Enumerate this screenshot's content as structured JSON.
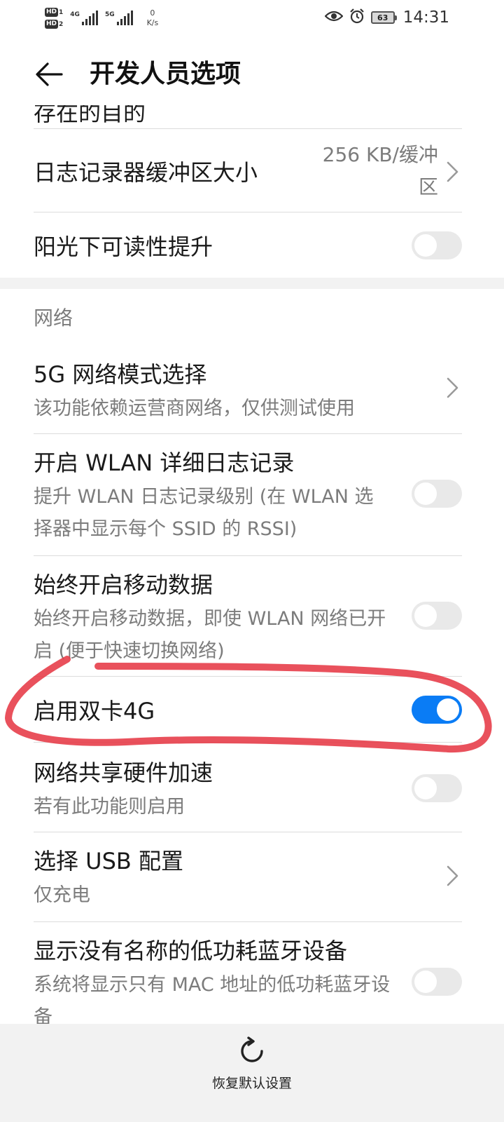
{
  "status_bar": {
    "sim1": "HD",
    "sim1_index": "1",
    "sim2": "HD",
    "sim2_index": "2",
    "net1": "4G",
    "net2": "5G",
    "net_speed_value": "0",
    "net_speed_unit": "K/s",
    "battery_level": "63",
    "time": "14:31",
    "icons": [
      "eye-icon",
      "alarm-icon",
      "battery-icon"
    ]
  },
  "header": {
    "title": "开发人员选项"
  },
  "settings": {
    "partial_top_item": "存在的目的",
    "log_buffer": {
      "title": "日志记录器缓冲区大小",
      "value": "256 KB/缓冲区"
    },
    "sunlight": {
      "title": "阳光下可读性提升",
      "enabled": false
    },
    "network_section": {
      "header": "网络",
      "items": [
        {
          "title": "5G 网络模式选择",
          "subtitle": "该功能依赖运营商网络，仅供测试使用"
        },
        {
          "title": "开启 WLAN 详细日志记录",
          "subtitle": "提升 WLAN 日志记录级别 (在 WLAN 选择器中显示每个 SSID 的 RSSI)",
          "enabled": false
        },
        {
          "title": "始终开启移动数据",
          "subtitle": "始终开启移动数据，即使 WLAN 网络已开启 (便于快速切换网络)",
          "enabled": false
        },
        {
          "title": "启用双卡4G",
          "enabled": true
        },
        {
          "title": "网络共享硬件加速",
          "subtitle": "若有此功能则启用",
          "enabled": false
        },
        {
          "title": "选择 USB 配置",
          "subtitle": "仅充电"
        },
        {
          "title": "显示没有名称的低功耗蓝牙设备",
          "subtitle": "系统将显示只有 MAC 地址的低功耗蓝牙设备",
          "enabled": false
        }
      ]
    }
  },
  "bottom_bar": {
    "reset_label": "恢复默认设置"
  },
  "colors": {
    "toggle_on": "#0a7cf5",
    "toggle_off": "#e9e9e9",
    "annotation": "#e63946",
    "secondary_text": "#7c7c7c"
  }
}
